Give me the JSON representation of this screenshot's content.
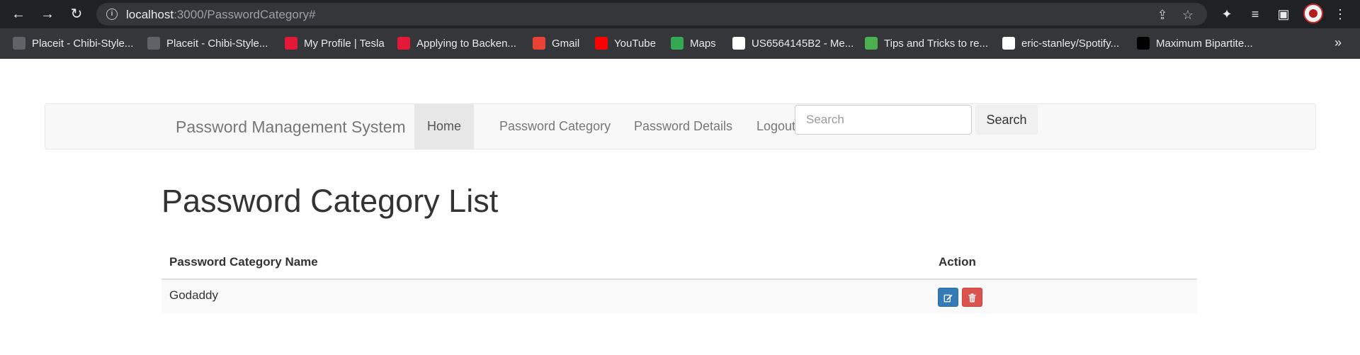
{
  "browser": {
    "url_host": "localhost",
    "url_path": ":3000/PasswordCategory#",
    "bookmarks": [
      {
        "label": "Placeit - Chibi-Style...",
        "icon": "placeit-icon",
        "color": "#5f6368"
      },
      {
        "label": "Placeit - Chibi-Style...",
        "icon": "placeit-icon",
        "color": "#5f6368"
      },
      {
        "label": "My Profile | Tesla",
        "icon": "tesla-icon",
        "color": "#e31937"
      },
      {
        "label": "Applying to Backen...",
        "icon": "tesla-icon",
        "color": "#e31937"
      },
      {
        "label": "Gmail",
        "icon": "gmail-icon",
        "color": "#ea4335"
      },
      {
        "label": "YouTube",
        "icon": "youtube-icon",
        "color": "#ff0000"
      },
      {
        "label": "Maps",
        "icon": "maps-icon",
        "color": "#34a853"
      },
      {
        "label": "US6564145B2 - Me...",
        "icon": "google-icon",
        "color": "#ffffff"
      },
      {
        "label": "Tips and Tricks to re...",
        "icon": "tips-icon",
        "color": "#4caf50"
      },
      {
        "label": "eric-stanley/Spotify...",
        "icon": "github-icon",
        "color": "#ffffff"
      },
      {
        "label": "Maximum Bipartite...",
        "icon": "th-icon",
        "color": "#000000"
      }
    ]
  },
  "navbar": {
    "brand": "Password Management System",
    "items": [
      {
        "label": "Home",
        "active": true
      },
      {
        "label": "Password Category",
        "active": false
      },
      {
        "label": "Password Details",
        "active": false
      },
      {
        "label": "Logout",
        "active": false
      }
    ],
    "search_placeholder": "Search",
    "search_button": "Search"
  },
  "main": {
    "title": "Password Category List",
    "table": {
      "headers": [
        "Password Category Name",
        "Action"
      ],
      "rows": [
        {
          "name": "Godaddy"
        }
      ]
    }
  },
  "colors": {
    "edit_button": "#337ab7",
    "delete_button": "#d9534f"
  }
}
